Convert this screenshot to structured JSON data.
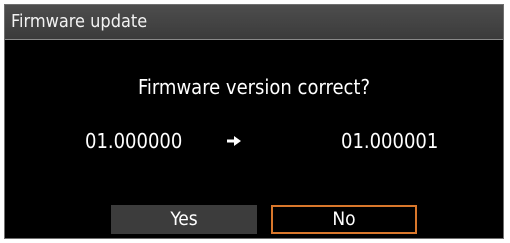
{
  "dialog": {
    "title": "Firmware update",
    "question": "Firmware version correct?",
    "current_version": "01.000000",
    "new_version": "01.000001",
    "arrow_icon": "right-arrow-icon",
    "buttons": {
      "yes_label": "Yes",
      "no_label": "No",
      "selected": "No"
    },
    "colors": {
      "background": "#000000",
      "titlebar": "#444444",
      "button": "#3c3c3c",
      "focus_border": "#d9772b"
    }
  }
}
